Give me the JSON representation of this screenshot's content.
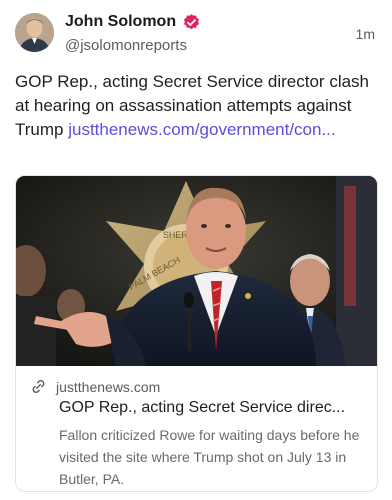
{
  "author": {
    "name": "John Solomon",
    "handle": "@jsolomonreports",
    "timestamp": "1m",
    "verified_icon": "verified-badge-icon",
    "verified_color": "#e0245e"
  },
  "post": {
    "text": "GOP Rep., acting Secret Service director clash at hearing on assassination attempts against Trump ",
    "link_text": "justthenews.com/government/con..."
  },
  "link_card": {
    "domain": "justthenews.com",
    "title": "GOP Rep., acting Secret Service direc...",
    "description": "Fallon criticized Rowe for waiting days before he visited the site where Trump shot on July 13 in Butler, PA.",
    "image_alt": "Acting Secret Service director speaking at a podium in front of a sheriff's star emblem",
    "badge_text_top": "SHERIFF'S",
    "badge_text_bottom": "PALM BEACH"
  },
  "colors": {
    "link": "#5a4fd6",
    "text": "#1f1f1f",
    "muted": "#5c5c5c"
  }
}
